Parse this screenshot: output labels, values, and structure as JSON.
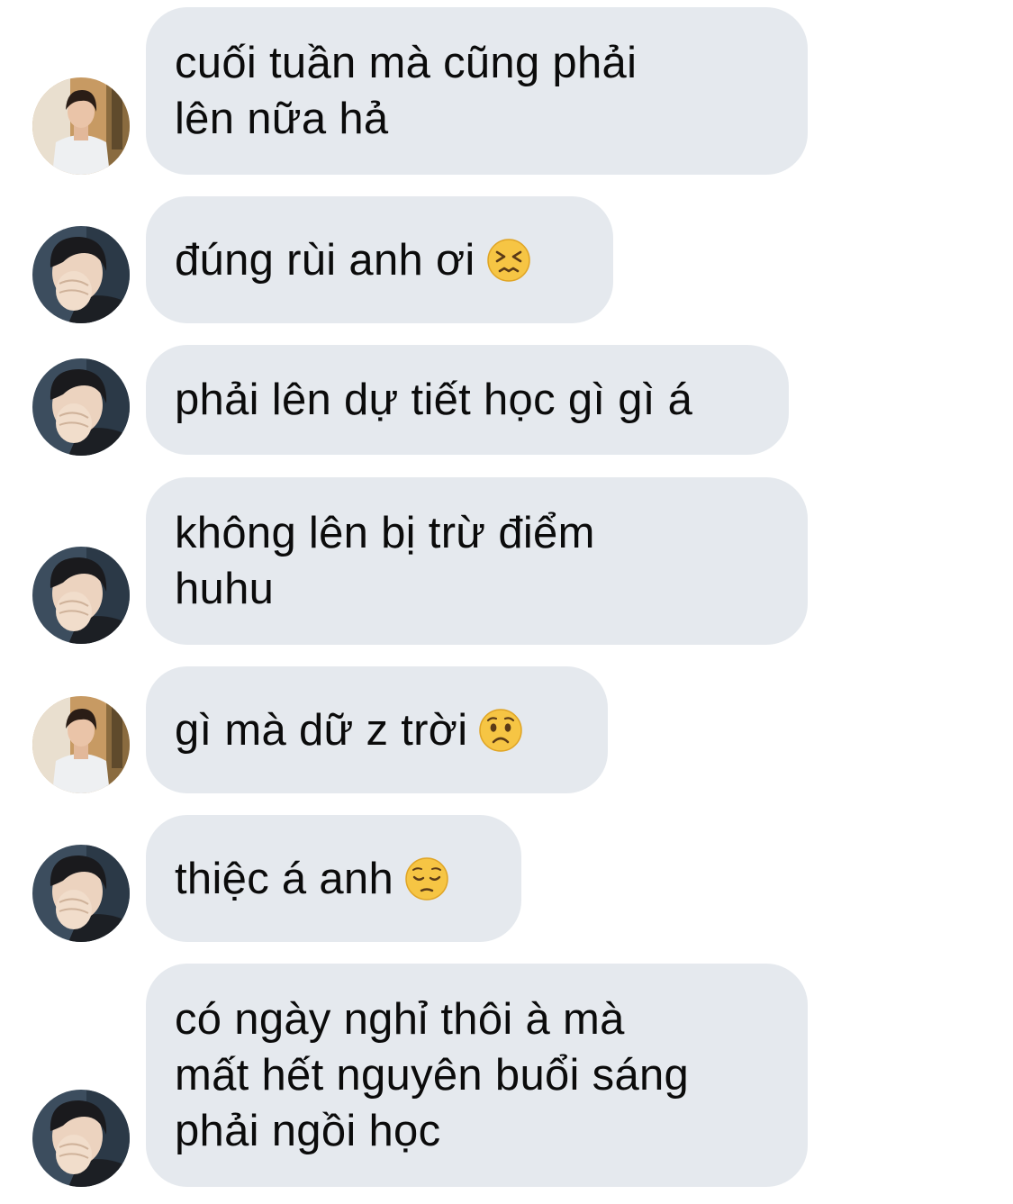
{
  "messages": [
    {
      "sender": "jin",
      "lines": [
        "cuối tuần mà cũng phải",
        "lên nữa hả"
      ],
      "emoji": null
    },
    {
      "sender": "jimin",
      "lines": [
        "đúng rùi anh ơi"
      ],
      "emoji": "persevering-face"
    },
    {
      "sender": "jimin",
      "lines": [
        "phải lên dự tiết học gì gì á"
      ],
      "emoji": null
    },
    {
      "sender": "jimin",
      "lines": [
        "không lên bị trừ điểm",
        "huhu"
      ],
      "emoji": null
    },
    {
      "sender": "jin",
      "lines": [
        "gì mà dữ z trời"
      ],
      "emoji": "worried-face"
    },
    {
      "sender": "jimin",
      "lines": [
        "thiệc á anh"
      ],
      "emoji": "pensive-face"
    },
    {
      "sender": "jimin",
      "lines": [
        "có ngày nghỉ thôi à mà",
        "mất hết nguyên buổi sáng",
        "phải ngồi học"
      ],
      "emoji": null
    }
  ],
  "colors": {
    "background": "#ffffff",
    "bubble": "#e5e9ee",
    "text": "#0b0b0b"
  }
}
